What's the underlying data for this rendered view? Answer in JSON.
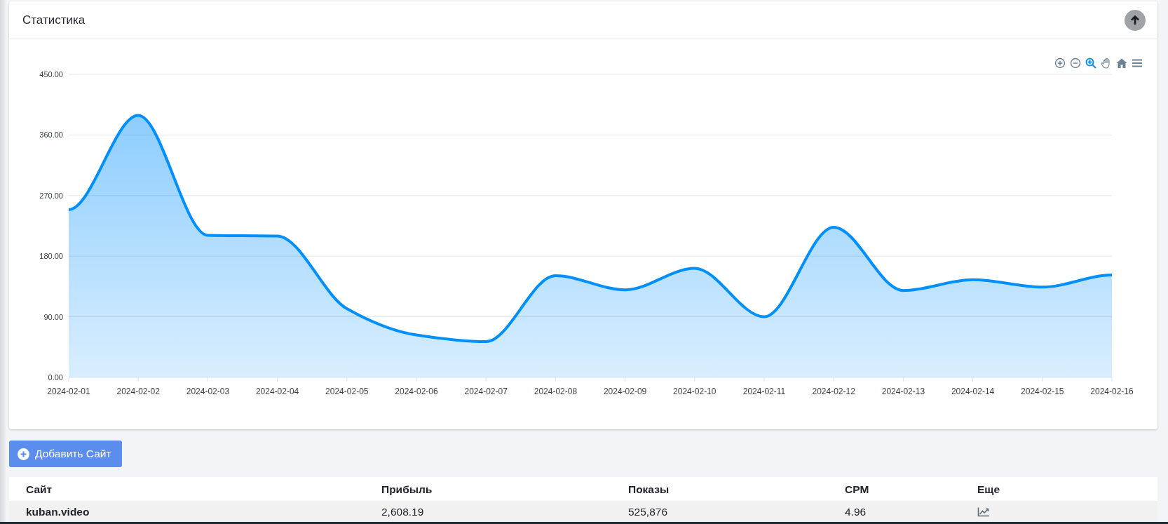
{
  "card": {
    "title": "Статистика",
    "chart_data": {
      "type": "area",
      "categories": [
        "2024-02-01",
        "2024-02-02",
        "2024-02-03",
        "2024-02-04",
        "2024-02-05",
        "2024-02-06",
        "2024-02-07",
        "2024-02-08",
        "2024-02-09",
        "2024-02-10",
        "2024-02-11",
        "2024-02-12",
        "2024-02-13",
        "2024-02-14",
        "2024-02-15",
        "2024-02-16"
      ],
      "grid": true,
      "series": [
        {
          "color": "#008ffb",
          "values": [
            249,
            389,
            211,
            210,
            102,
            63,
            53,
            151,
            130,
            162,
            90,
            223,
            129,
            145,
            134,
            152
          ]
        }
      ],
      "ylim": [
        0,
        450
      ],
      "yticks": [
        {
          "value": 0,
          "label": "0.00"
        },
        {
          "value": 90,
          "label": "90.00"
        },
        {
          "value": 180,
          "label": "180.00"
        },
        {
          "value": 270,
          "label": "270.00"
        },
        {
          "value": 360,
          "label": "360.00"
        },
        {
          "value": 450,
          "label": "450.00"
        }
      ]
    }
  },
  "add_button": {
    "label": "Добавить Сайт"
  },
  "table": {
    "columns": [
      "Сайт",
      "Прибыль",
      "Показы",
      "CPM",
      "Еще"
    ],
    "rows": [
      {
        "cells": [
          "kuban.video",
          "2,608.19",
          "525,876",
          "4.96"
        ]
      }
    ]
  }
}
